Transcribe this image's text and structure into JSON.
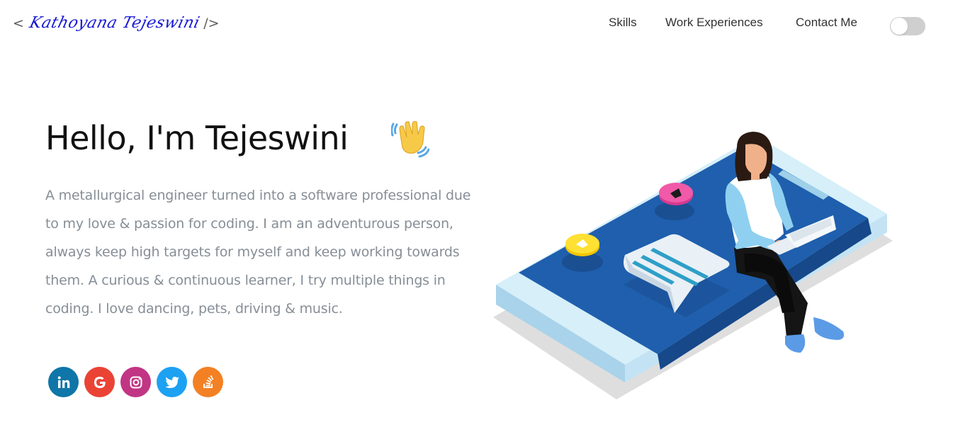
{
  "header": {
    "logo": {
      "open_bracket": "<",
      "signature": "Kathoyana Tejeswini",
      "close_bracket": "/>"
    },
    "menu": [
      {
        "label": "Skills"
      },
      {
        "label": "Work Experiences"
      },
      {
        "label": "Contact Me"
      }
    ],
    "theme_toggle": {
      "state": "off"
    }
  },
  "hero": {
    "greeting": "Hello, I'm Tejeswini",
    "wave_emoji": "waving-hand-icon",
    "description": "A metallurgical engineer turned into a software professional due to my love & passion for coding. I am an adventurous person, always keep high targets for myself and keep working towards them. A curious & continuous learner, I try multiple things in coding. I love dancing, pets, driving & music."
  },
  "social_links": [
    {
      "name": "linkedin-icon",
      "color": "#0e76a8"
    },
    {
      "name": "google-icon",
      "color": "#ea4335"
    },
    {
      "name": "instagram-icon",
      "color": "#c13584"
    },
    {
      "name": "twitter-icon",
      "color": "#1da1f2"
    },
    {
      "name": "stackoverflow-icon",
      "color": "#f48024"
    }
  ],
  "illustration": {
    "name": "woman-with-laptop-on-phone-illustration"
  }
}
